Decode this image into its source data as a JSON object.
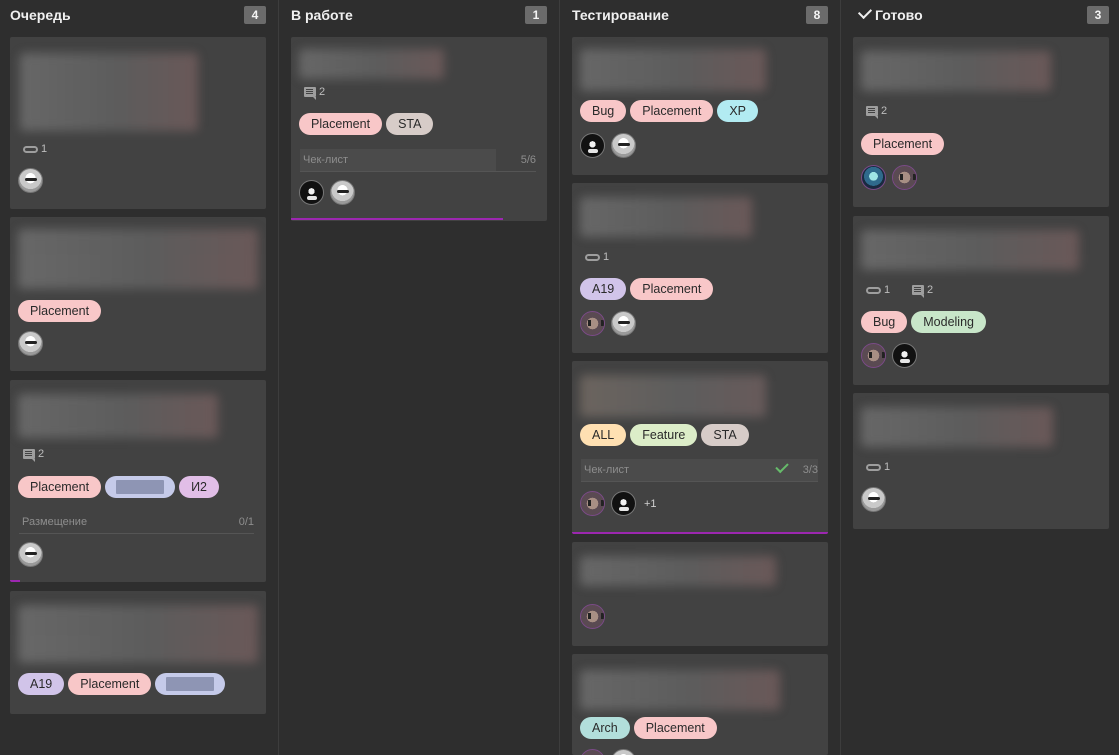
{
  "columns": [
    {
      "title": "Очередь",
      "count": "4"
    },
    {
      "title": "В работе",
      "count": "1"
    },
    {
      "title": "Тестирование",
      "count": "8"
    },
    {
      "title": "Готово",
      "count": "3"
    }
  ],
  "cards": {
    "q1": {
      "attachments": "1"
    },
    "q2": {
      "tags": [
        "Placement"
      ]
    },
    "q3": {
      "comments": "2",
      "tags": [
        "Placement",
        "И2"
      ],
      "checklist_label": "Размещение",
      "checklist_count": "0/1"
    },
    "q4": {
      "tags": [
        "A19",
        "Placement"
      ]
    },
    "w1": {
      "comments": "2",
      "tags": [
        "Placement",
        "STA"
      ],
      "checklist_label": "Чек-лист",
      "checklist_count": "5/6"
    },
    "t1": {
      "tags": [
        "Bug",
        "Placement",
        "XP"
      ]
    },
    "t2": {
      "attachments": "1",
      "tags": [
        "A19",
        "Placement"
      ]
    },
    "t3": {
      "tags": [
        "ALL",
        "Feature",
        "STA"
      ],
      "checklist_label": "Чек-лист",
      "checklist_count": "3/3",
      "more_assignees": "+1"
    },
    "t5": {
      "tags": [
        "Arch",
        "Placement"
      ]
    },
    "d1": {
      "comments": "2",
      "tags": [
        "Placement"
      ]
    },
    "d2": {
      "attachments": "1",
      "comments": "2",
      "tags": [
        "Bug",
        "Modeling"
      ]
    },
    "d3": {
      "attachments": "1"
    }
  },
  "progress": {
    "q3": 0.04,
    "w1": 0.83,
    "t3": 1.0
  },
  "colors": {
    "background": "#2e2e2e",
    "card": "#424242",
    "count_badge": "#6b6b6b",
    "tag_placement": "#f8c7c8",
    "tag_bug": "#f8c7c8",
    "tag_sta": "#d7ccc8",
    "tag_xp": "#b2ebf2",
    "tag_a19": "#d1c4e9",
    "tag_i2": "#e1bee7",
    "tag_all": "#ffe0b2",
    "tag_feature": "#dcedc8",
    "tag_modeling": "#c8e6c9",
    "tag_arch": "#b2dfdb",
    "tag_redacted": "#c5cae9",
    "progress_bar": "#9c27b0",
    "check_ok": "#66bb6a"
  },
  "icons": [
    "paperclip-icon",
    "comment-icon",
    "checkmark-icon",
    "avatar"
  ]
}
